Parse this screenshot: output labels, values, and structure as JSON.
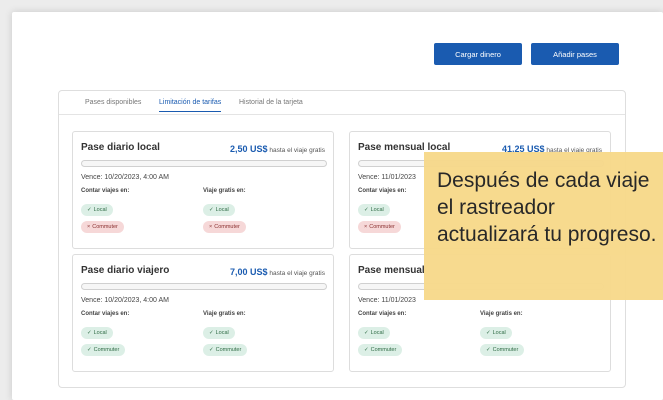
{
  "toolbar": {
    "load_label": "Cargar dinero",
    "add_label": "Añadir pases"
  },
  "tabs": [
    {
      "label": "Pases disponibles",
      "active": false
    },
    {
      "label": "Limitación de tarifas",
      "active": true
    },
    {
      "label": "Historial de la tarjeta",
      "active": false
    }
  ],
  "passes": [
    {
      "title": "Pase diario local",
      "amount": "2,50 US$",
      "suffix": "hasta el viaje gratis",
      "progress": 0,
      "expires": "Vence: 10/20/2023, 4:00 AM",
      "count_label": "Contar viajes en:",
      "free_label": "Viaje gratis en:",
      "count_chips": [
        {
          "label": "Local",
          "ok": true
        },
        {
          "label": "Commuter",
          "ok": false
        }
      ],
      "free_chips": [
        {
          "label": "Local",
          "ok": true
        },
        {
          "label": "Commuter",
          "ok": false
        }
      ]
    },
    {
      "title": "Pase mensual local",
      "amount": "41,25 US$",
      "suffix": "hasta el viaje gratis",
      "progress": 0,
      "expires": "Vence: 11/01/2023",
      "count_label": "Contar viajes en:",
      "free_label": "",
      "count_chips": [
        {
          "label": "Local",
          "ok": true
        },
        {
          "label": "Commuter",
          "ok": false
        }
      ],
      "free_chips": []
    },
    {
      "title": "Pase diario viajero",
      "amount": "7,00 US$",
      "suffix": "hasta el viaje gratis",
      "progress": 0,
      "expires": "Vence: 10/20/2023, 4:00 AM",
      "count_label": "Contar viajes en:",
      "free_label": "Viaje gratis en:",
      "count_chips": [
        {
          "label": "Local",
          "ok": true
        },
        {
          "label": "Commuter",
          "ok": true
        }
      ],
      "free_chips": [
        {
          "label": "Local",
          "ok": true
        },
        {
          "label": "Commuter",
          "ok": true
        }
      ]
    },
    {
      "title": "Pase mensual",
      "amount": "",
      "suffix": "",
      "progress": 0,
      "expires": "Vence: 11/01/2023",
      "count_label": "Contar viajes en:",
      "free_label": "Viaje gratis en:",
      "count_chips": [
        {
          "label": "Local",
          "ok": true
        },
        {
          "label": "Commuter",
          "ok": true
        }
      ],
      "free_chips": [
        {
          "label": "Local",
          "ok": true
        },
        {
          "label": "Commuter",
          "ok": true
        }
      ]
    }
  ],
  "callout": {
    "text": "Después de cada viaje el rastreador actualizará tu progreso."
  },
  "colors": {
    "accent": "#1a5bb0",
    "chip_ok": "#dcefe6",
    "chip_no": "#f6d8d8",
    "callout": "#f7d98b"
  },
  "icons": {
    "ok": "check-icon",
    "no": "x-icon"
  }
}
